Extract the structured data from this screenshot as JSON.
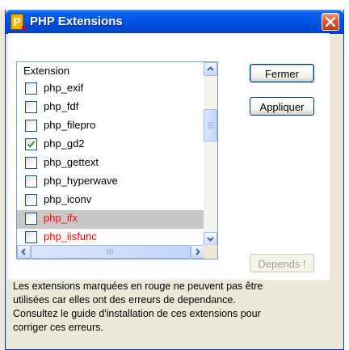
{
  "window": {
    "title": "PHP Extensions"
  },
  "list": {
    "header": "Extension",
    "items": [
      {
        "label": "php_exif",
        "checked": false,
        "error": false
      },
      {
        "label": "php_fdf",
        "checked": false,
        "error": false
      },
      {
        "label": "php_filepro",
        "checked": false,
        "error": false
      },
      {
        "label": "php_gd2",
        "checked": true,
        "error": false
      },
      {
        "label": "php_gettext",
        "checked": false,
        "error": false
      },
      {
        "label": "php_hyperwave",
        "checked": false,
        "error": false
      },
      {
        "label": "php_iconv",
        "checked": false,
        "error": false
      },
      {
        "label": "php_ifx",
        "checked": false,
        "error": true,
        "selected": true
      },
      {
        "label": "php_iisfunc",
        "checked": false,
        "error": true
      }
    ]
  },
  "buttons": {
    "close": "Fermer",
    "apply": "Appliquer",
    "depends": "Depends !"
  },
  "description": {
    "line1": "Les extensions marquées en rouge ne peuvent pas être",
    "line2": "utilisées car elles ont des erreurs de dependance.",
    "line3": "Consultez le guide d'installation de ces extensions pour",
    "line4": "corriger ces erreurs."
  },
  "colors": {
    "error_text": "#ff0000",
    "title_bar": "#0055e5",
    "close_button": "#e05a30"
  }
}
